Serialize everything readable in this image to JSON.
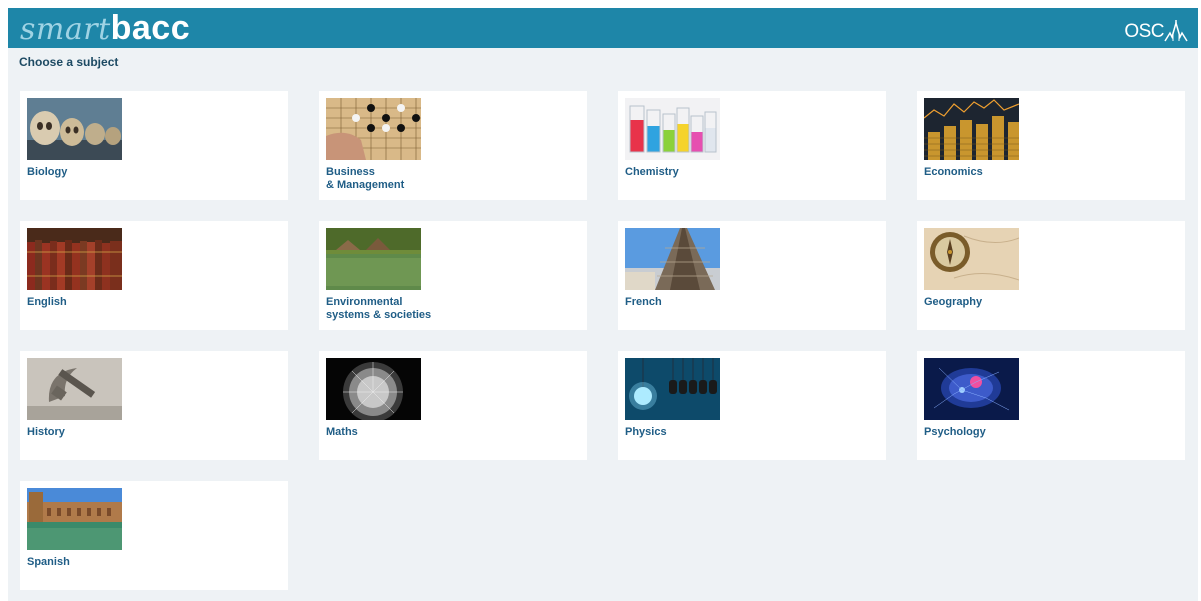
{
  "header": {
    "logo_part1": "smart",
    "logo_part2": "bacc",
    "brand": "OSC"
  },
  "page": {
    "heading": "Choose a subject"
  },
  "subjects": [
    {
      "label": "Biology",
      "icon": "skulls-image"
    },
    {
      "label": "Business\n& Management",
      "icon": "go-board-image"
    },
    {
      "label": "Chemistry",
      "icon": "flasks-image"
    },
    {
      "label": "Economics",
      "icon": "coins-image"
    },
    {
      "label": "English",
      "icon": "books-image"
    },
    {
      "label": "Environmental\nsystems & societies",
      "icon": "lake-image"
    },
    {
      "label": "French",
      "icon": "eiffel-tower-image"
    },
    {
      "label": "Geography",
      "icon": "compass-image"
    },
    {
      "label": "History",
      "icon": "hammer-sickle-image"
    },
    {
      "label": "Maths",
      "icon": "dandelion-image"
    },
    {
      "label": "Physics",
      "icon": "light-bulbs-image"
    },
    {
      "label": "Psychology",
      "icon": "brain-image"
    },
    {
      "label": "Spanish",
      "icon": "plaza-image"
    }
  ],
  "colors": {
    "header_bg": "#1e86a8",
    "page_bg": "#eef2f5",
    "card_bg": "#ffffff",
    "label_text": "#1f5d86",
    "heading_text": "#1d4a63"
  }
}
